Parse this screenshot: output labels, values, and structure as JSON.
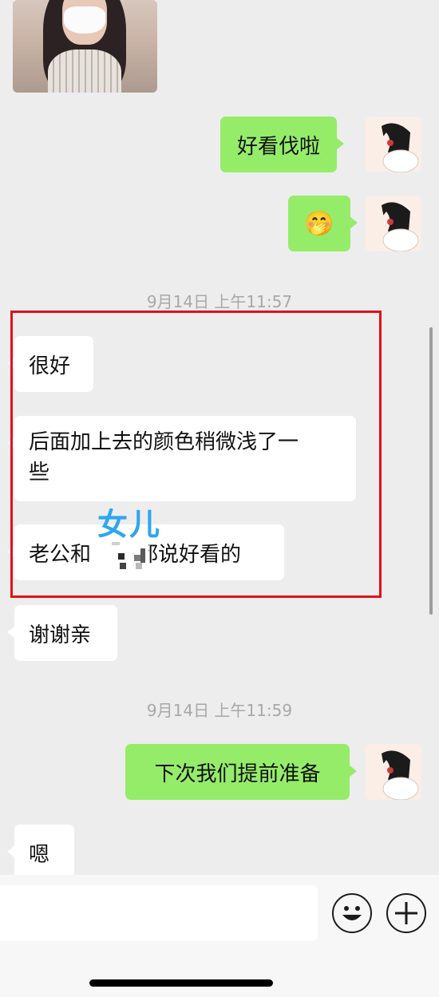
{
  "chat": {
    "messages": [
      {
        "side": "mine",
        "text": "好看伐啦"
      },
      {
        "side": "mine",
        "text": "🤭"
      },
      {
        "side": "theirs",
        "text": "很好"
      },
      {
        "side": "theirs",
        "line1": "后面加上去的颜色稍微浅了一",
        "line2": "些"
      },
      {
        "side": "theirs",
        "pre": "老公和",
        "post": "都说好看的"
      },
      {
        "side": "theirs",
        "text": "谢谢亲"
      },
      {
        "side": "mine",
        "text": "下次我们提前准备"
      },
      {
        "side": "theirs",
        "text": "嗯"
      }
    ],
    "timestamps": [
      "9月14日 上午11:57",
      "9月14日 上午11:59"
    ]
  },
  "annotation": {
    "overlay_text": "女儿",
    "highlight_color": "#e31019",
    "overlay_color": "#2ea6f0"
  },
  "colors": {
    "mine_bubble": "#95ec69",
    "theirs_bubble": "#ffffff",
    "background": "#ededed"
  },
  "input_bar": {
    "emoji_icon": "smiley-icon",
    "plus_icon": "plus-icon"
  }
}
